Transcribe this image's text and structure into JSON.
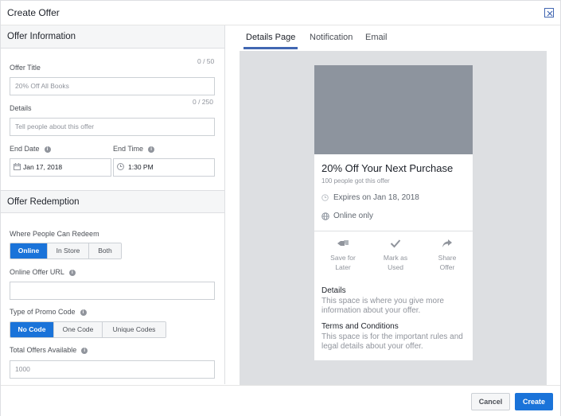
{
  "dialog": {
    "title": "Create Offer"
  },
  "offer_info": {
    "heading": "Offer Information",
    "title_label": "Offer Title",
    "title_counter": "0 / 50",
    "title_placeholder": "20% Off All Books",
    "details_label": "Details",
    "details_counter": "0 / 250",
    "details_placeholder": "Tell people about this offer",
    "end_date_label": "End Date",
    "end_date_value": "Jan 17, 2018",
    "end_time_label": "End Time",
    "end_time_value": "1:30 PM"
  },
  "redemption": {
    "heading": "Offer Redemption",
    "where_label": "Where People Can Redeem",
    "where_options": [
      "Online",
      "In Store",
      "Both"
    ],
    "url_label": "Online Offer URL",
    "url_value": "",
    "promo_label": "Type of Promo Code",
    "promo_options": [
      "No Code",
      "One Code",
      "Unique Codes"
    ],
    "total_label": "Total Offers Available",
    "total_placeholder": "1000"
  },
  "preview": {
    "tabs": [
      "Details Page",
      "Notification",
      "Email"
    ],
    "card": {
      "title": "20% Off Your Next Purchase",
      "subtitle": "100 people got this offer",
      "expires": "Expires on Jan 18, 2018",
      "online": "Online only",
      "actions": [
        {
          "line1": "Save for",
          "line2": "Later",
          "icon": "save-later-icon"
        },
        {
          "line1": "Mark as",
          "line2": "Used",
          "icon": "checkmark-icon"
        },
        {
          "line1": "Share",
          "line2": "Offer",
          "icon": "share-arrow-icon"
        }
      ],
      "details_heading": "Details",
      "details_text": "This space is where you give more information about your offer.",
      "terms_heading": "Terms and Conditions",
      "terms_text": "This space is for the important rules and legal details about your offer."
    }
  },
  "footer": {
    "cancel": "Cancel",
    "create": "Create"
  },
  "colors": {
    "accent": "#1a73d9",
    "tab_underline": "#4267b2",
    "image_placeholder": "#8d949e"
  }
}
